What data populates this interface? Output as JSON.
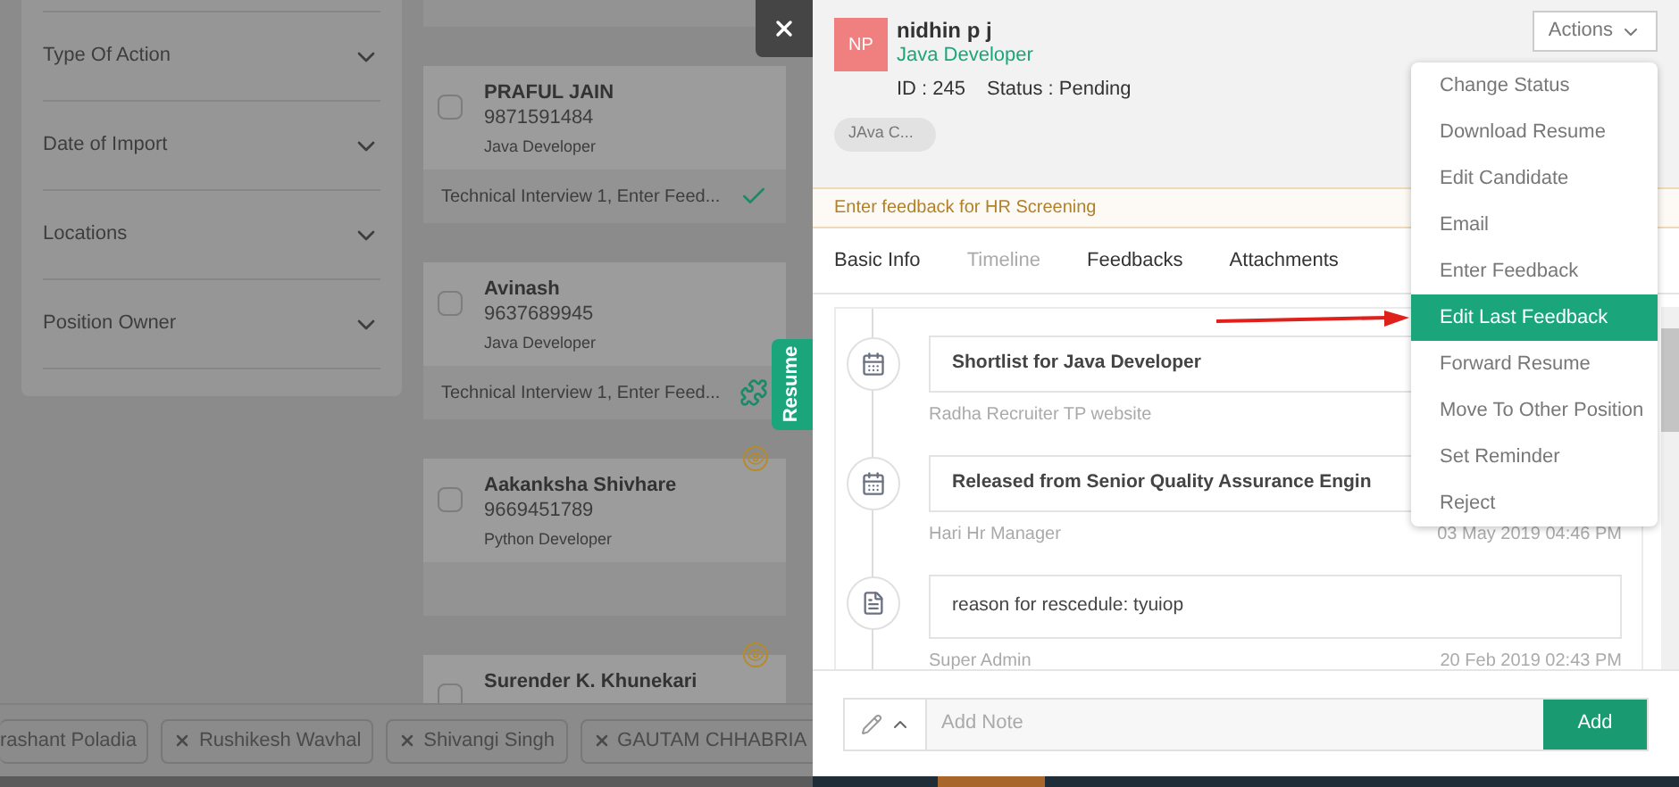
{
  "filters": [
    {
      "label": "Type Of Action"
    },
    {
      "label": "Date of Import"
    },
    {
      "label": "Locations"
    },
    {
      "label": "Position Owner"
    }
  ],
  "candidates": [
    {
      "name": "PRAFUL JAIN",
      "phone": "9871591484",
      "role": "Java Developer",
      "checked": false,
      "viewed": false,
      "stage": "Technical Interview 1, Enter Feed...",
      "kind": "check"
    },
    {
      "name": "Avinash",
      "phone": "9637689945",
      "role": "Java Developer",
      "checked": false,
      "viewed": false,
      "stage": "Technical Interview 1, Enter Feed...",
      "kind": "puzzle"
    },
    {
      "name": "Aakanksha Shivhare",
      "phone": "9669451789",
      "role": "Python Developer",
      "checked": false,
      "viewed": true
    },
    {
      "name": "Surender K. Khunekari",
      "checked": false,
      "viewed": true
    }
  ],
  "resume_tab": "Resume",
  "chips": [
    {
      "label": "rashant Poladia",
      "removable": false
    },
    {
      "label": "Rushikesh Wavhal",
      "removable": true
    },
    {
      "label": "Shivangi Singh",
      "removable": true
    },
    {
      "label": "GAUTAM CHHABRIA",
      "removable": true
    }
  ],
  "profile": {
    "initials": "NP",
    "color": "#f08080",
    "name": "nidhin p j",
    "role": "Java Developer",
    "id": "ID : 245",
    "status": "Status : Pending",
    "tag": "JAva C..."
  },
  "actions": {
    "label": "Actions",
    "items": [
      {
        "label": "Change Status",
        "selected": false
      },
      {
        "label": "Download Resume",
        "selected": false
      },
      {
        "label": "Edit Candidate",
        "selected": false
      },
      {
        "label": "Email",
        "selected": false
      },
      {
        "label": "Enter Feedback",
        "selected": false
      },
      {
        "label": "Edit Last Feedback",
        "selected": true
      },
      {
        "label": "Forward Resume",
        "selected": false
      },
      {
        "label": "Move To Other Position",
        "selected": false
      },
      {
        "label": "Set Reminder",
        "selected": false
      },
      {
        "label": "Reject",
        "selected": false
      }
    ]
  },
  "feedback_prompt": "Enter feedback for HR Screening",
  "tabs": [
    {
      "label": "Basic Info",
      "selected": false
    },
    {
      "label": "Timeline",
      "selected": true
    },
    {
      "label": "Feedbacks",
      "selected": false
    },
    {
      "label": "Attachments",
      "selected": false
    }
  ],
  "timeline": [
    {
      "kind": "calendar",
      "title": "Shortlist for Java Developer",
      "author": "Radha Recruiter TP website"
    },
    {
      "kind": "calendar",
      "title": "Released from Senior Quality Assurance Engin",
      "author": "Hari Hr Manager",
      "time": "03 May 2019 04:46 PM"
    },
    {
      "kind": "document",
      "title": "reason for rescedule: tyuiop",
      "author": "Super Admin",
      "time": "20 Feb 2019 02:43 PM"
    }
  ],
  "note": {
    "placeholder": "Add Note",
    "button": "Add"
  }
}
